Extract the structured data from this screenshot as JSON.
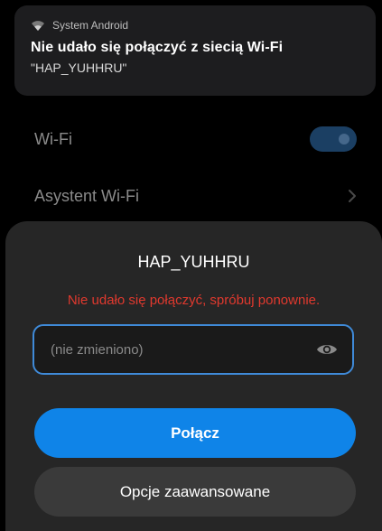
{
  "notification": {
    "app_name": "System Android",
    "icon": "wifi-icon",
    "title": "Nie udało się połączyć z siecią Wi-Fi",
    "body": "\"HAP_YUHHRU\""
  },
  "settings": {
    "wifi_label": "Wi-Fi",
    "wifi_enabled": true,
    "assistant_label": "Asystent Wi-Fi"
  },
  "dialog": {
    "title": "HAP_YUHHRU",
    "error": "Nie udało się połączyć, spróbuj ponownie.",
    "password_placeholder": "(nie zmieniono)",
    "password_value": "",
    "connect_label": "Połącz",
    "advanced_label": "Opcje zaawansowane"
  },
  "colors": {
    "accent": "#0f84e8",
    "error": "#e0392e",
    "field_border": "#3f8ad8"
  }
}
